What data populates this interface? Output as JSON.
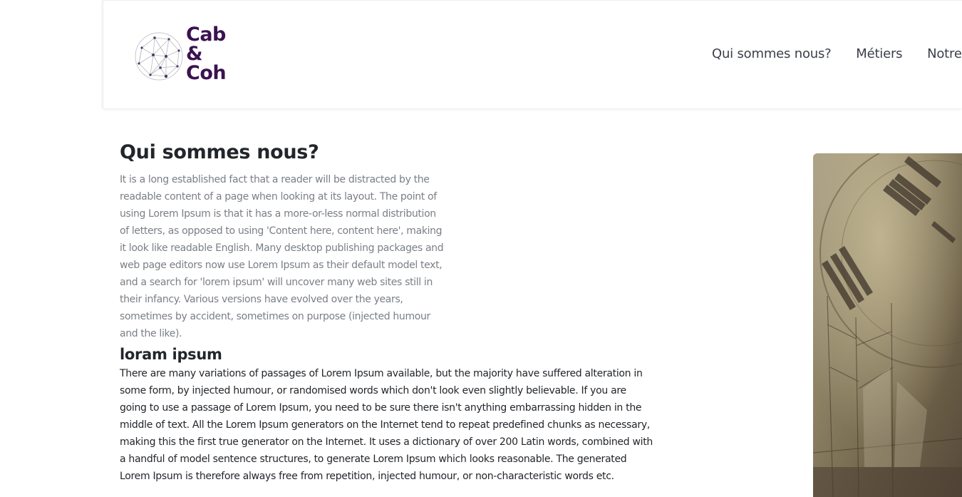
{
  "brand": {
    "name_line1": "Cab",
    "name_line2": "&",
    "name_line3": "Coh",
    "color": "#3a1250"
  },
  "nav": {
    "items": [
      {
        "label": "Qui sommes nous?"
      },
      {
        "label": "Métiers"
      },
      {
        "label": "Notre"
      }
    ]
  },
  "main": {
    "title": "Qui sommes nous?",
    "intro": "It is a long established fact that a reader will be distracted by the readable content of a page when looking at its layout. The point of using Lorem Ipsum is that it has a more-or-less normal distribution of letters, as opposed to using 'Content here, content here', making it look like readable English. Many desktop publishing packages and web page editors now use Lorem Ipsum as their default model text, and a search for 'lorem ipsum' will uncover many web sites still in their infancy. Various versions have evolved over the years, sometimes by accident, sometimes on purpose (injected humour and the like).",
    "section_title": "loram ipsum",
    "section_body": "There are many variations of passages of Lorem Ipsum available, but the majority have suffered alteration in some form, by injected humour, or randomised words which don't look even slightly believable. If you are going to use a passage of Lorem Ipsum, you need to be sure there isn't anything embarrassing hidden in the middle of text. All the Lorem Ipsum generators on the Internet tend to repeat predefined chunks as necessary, making this the first true generator on the Internet. It uses a dictionary of over 200 Latin words, combined with a handful of model sentence structures, to generate Lorem Ipsum which looks reasonable. The generated Lorem Ipsum is therefore always free from repetition, injected humour, or non-characteristic words etc."
  },
  "hero_image": {
    "icon": "vintage-clock-ship-image"
  },
  "colors": {
    "heading": "#22262b",
    "muted_text": "#7a7f86",
    "nav_text": "#3a3f48"
  }
}
